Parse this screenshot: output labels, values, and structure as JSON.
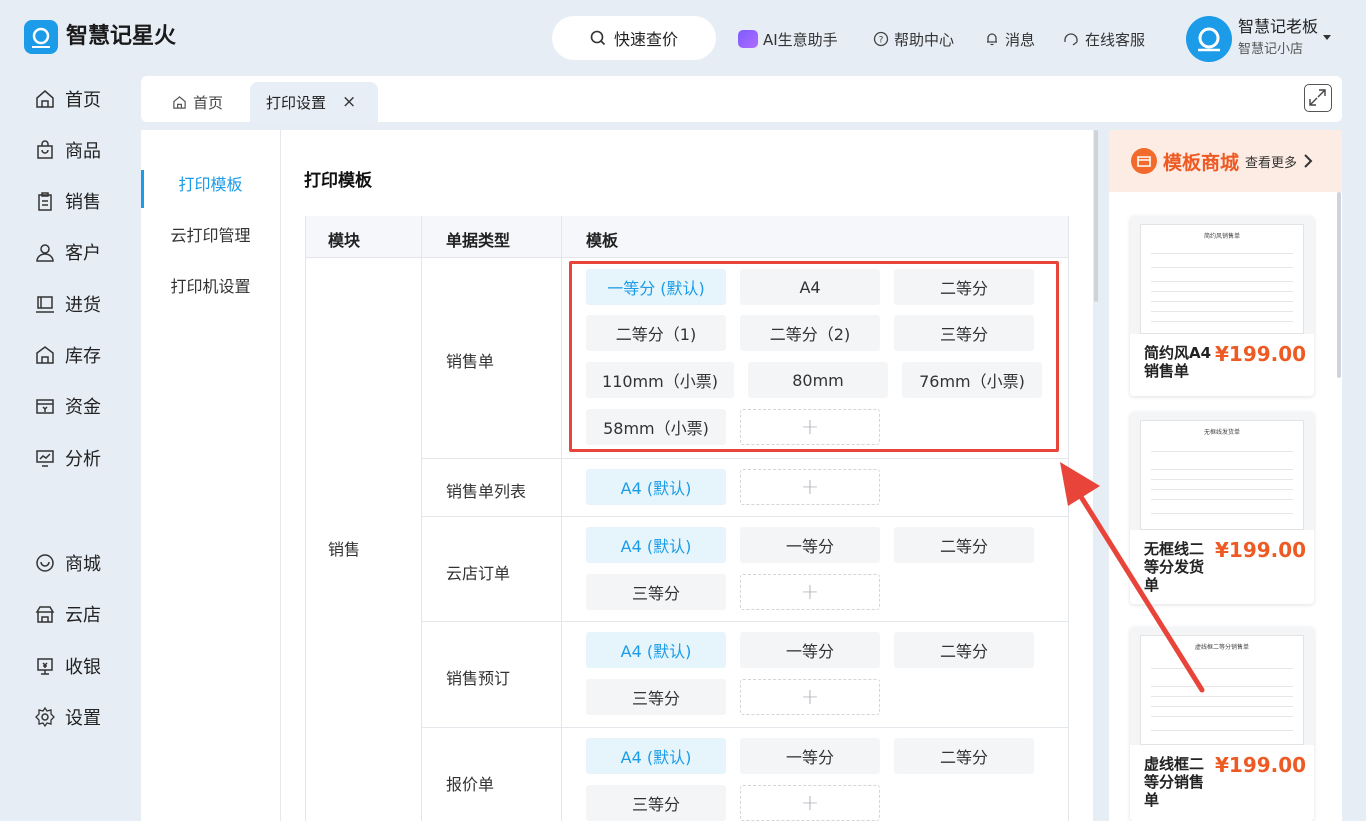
{
  "header": {
    "app_name": "智慧记星火",
    "search_label": "快速查价",
    "links": [
      "AI生意助手",
      "帮助中心",
      "消息",
      "在线客服"
    ],
    "user_name": "智慧记老板",
    "shop_name": "智慧记小店"
  },
  "sidebar": {
    "items": [
      "首页",
      "商品",
      "销售",
      "客户",
      "进货",
      "库存",
      "资金",
      "分析",
      "商城",
      "云店",
      "收银",
      "设置"
    ]
  },
  "tabs": {
    "home": "首页",
    "active": "打印设置",
    "close": "×"
  },
  "subnav": {
    "items": [
      "打印模板",
      "云打印管理",
      "打印机设置"
    ],
    "active_index": 0
  },
  "main": {
    "title": "打印模板",
    "columns": [
      "模块",
      "单据类型",
      "模板"
    ],
    "module": "销售",
    "rows": [
      {
        "type": "销售单",
        "templates": [
          "一等分 (默认)",
          "A4",
          "二等分",
          "二等分（1)",
          "二等分（2)",
          "三等分",
          "110mm（小票)",
          "80mm",
          "76mm（小票)",
          "58mm（小票)"
        ]
      },
      {
        "type": "销售单列表",
        "templates": [
          "A4 (默认)"
        ]
      },
      {
        "type": "云店订单",
        "templates": [
          "A4 (默认)",
          "一等分",
          "二等分",
          "三等分"
        ]
      },
      {
        "type": "销售预订",
        "templates": [
          "A4 (默认)",
          "一等分",
          "二等分",
          "三等分"
        ]
      },
      {
        "type": "报价单",
        "templates": [
          "A4 (默认)",
          "一等分",
          "二等分",
          "三等分"
        ]
      }
    ],
    "add_symbol": "+"
  },
  "template_store": {
    "title": "模板商城",
    "more": "查看更多",
    "cards": [
      {
        "name": "简约风A4销售单",
        "price": "¥199.00",
        "preview_title": "简约风销售单"
      },
      {
        "name": "无框线二等分发货单",
        "price": "¥199.00",
        "preview_title": "无框线发货单"
      },
      {
        "name": "虚线框二等分销售单",
        "price": "¥199.00",
        "preview_title": "虚线框二等分销售单"
      }
    ]
  },
  "colors": {
    "accent": "#1b9be8",
    "price": "#ee5a24",
    "highlight": "#e8443a"
  }
}
